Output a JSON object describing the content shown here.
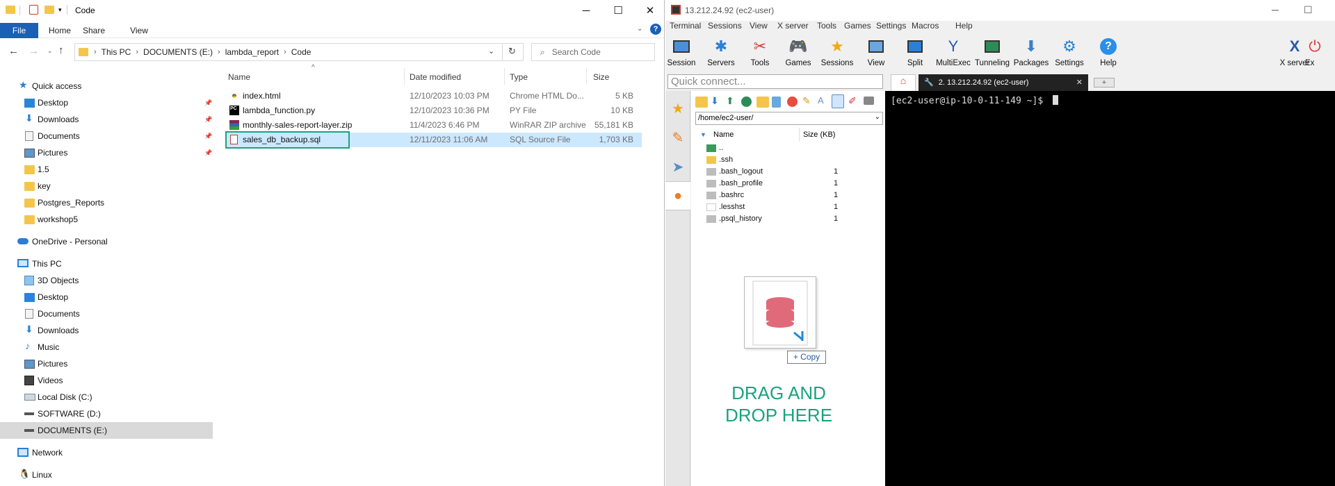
{
  "explorer": {
    "title": "Code",
    "ribbon_tabs": [
      "File",
      "Home",
      "Share",
      "View"
    ],
    "breadcrumb": [
      "This PC",
      "DOCUMENTS (E:)",
      "lambda_report",
      "Code"
    ],
    "search_placeholder": "Search Code",
    "nav_tree": [
      {
        "label": "Quick access",
        "icon": "star-icon",
        "indent": 0
      },
      {
        "label": "Desktop",
        "icon": "desktop-icon",
        "indent": 1,
        "pinned": true
      },
      {
        "label": "Downloads",
        "icon": "download-icon",
        "indent": 1,
        "pinned": true
      },
      {
        "label": "Documents",
        "icon": "documents-icon",
        "indent": 1,
        "pinned": true
      },
      {
        "label": "Pictures",
        "icon": "pictures-icon",
        "indent": 1,
        "pinned": true
      },
      {
        "label": "1.5",
        "icon": "folder-icon",
        "indent": 1
      },
      {
        "label": "key",
        "icon": "folder-icon",
        "indent": 1
      },
      {
        "label": "Postgres_Reports",
        "icon": "folder-icon",
        "indent": 1
      },
      {
        "label": "workshop5",
        "icon": "folder-icon",
        "indent": 1
      },
      {
        "label": "OneDrive - Personal",
        "icon": "cloud-icon",
        "indent": 0
      },
      {
        "label": "This PC",
        "icon": "computer-icon",
        "indent": 0
      },
      {
        "label": "3D Objects",
        "icon": "cube-icon",
        "indent": 1
      },
      {
        "label": "Desktop",
        "icon": "desktop-icon",
        "indent": 1
      },
      {
        "label": "Documents",
        "icon": "documents-icon",
        "indent": 1
      },
      {
        "label": "Downloads",
        "icon": "download-icon",
        "indent": 1
      },
      {
        "label": "Music",
        "icon": "music-icon",
        "indent": 1
      },
      {
        "label": "Pictures",
        "icon": "pictures-icon",
        "indent": 1
      },
      {
        "label": "Videos",
        "icon": "video-icon",
        "indent": 1
      },
      {
        "label": "Local Disk (C:)",
        "icon": "disk-icon",
        "indent": 1
      },
      {
        "label": "SOFTWARE (D:)",
        "icon": "drive-icon",
        "indent": 1
      },
      {
        "label": "DOCUMENTS (E:)",
        "icon": "drive-icon",
        "indent": 1,
        "selected": true
      },
      {
        "label": "Network",
        "icon": "network-icon",
        "indent": 0
      },
      {
        "label": "Linux",
        "icon": "linux-icon",
        "indent": 0
      }
    ],
    "columns": [
      "Name",
      "Date modified",
      "Type",
      "Size"
    ],
    "files": [
      {
        "name": "index.html",
        "date": "12/10/2023 10:03 PM",
        "type": "Chrome HTML Do...",
        "size": "5 KB",
        "icon": "chrome-icon"
      },
      {
        "name": "lambda_function.py",
        "date": "12/10/2023 10:36 PM",
        "type": "PY File",
        "size": "10 KB",
        "icon": "pycharm-icon"
      },
      {
        "name": "monthly-sales-report-layer.zip",
        "date": "11/4/2023 6:46 PM",
        "type": "WinRAR ZIP archive",
        "size": "55,181 KB",
        "icon": "winrar-icon"
      },
      {
        "name": "sales_db_backup.sql",
        "date": "12/11/2023 11:06 AM",
        "type": "SQL Source File",
        "size": "1,703 KB",
        "icon": "sql-file-icon",
        "selected": true
      }
    ],
    "accent": "#1b5fb7",
    "selection_color": "#cce8ff",
    "highlight_border": "#1aa37d"
  },
  "mobaxterm": {
    "title": "13.212.24.92 (ec2-user)",
    "menu": [
      "Terminal",
      "Sessions",
      "View",
      "X server",
      "Tools",
      "Games",
      "Settings",
      "Macros",
      "Help"
    ],
    "toolbar": [
      {
        "label": "Session",
        "icon": "session-icon"
      },
      {
        "label": "Servers",
        "icon": "servers-icon"
      },
      {
        "label": "Tools",
        "icon": "tools-icon"
      },
      {
        "label": "Games",
        "icon": "games-icon"
      },
      {
        "label": "Sessions",
        "icon": "sessions-star-icon"
      },
      {
        "label": "View",
        "icon": "view-icon"
      },
      {
        "label": "Split",
        "icon": "split-icon"
      },
      {
        "label": "MultiExec",
        "icon": "multiexec-icon"
      },
      {
        "label": "Tunneling",
        "icon": "tunneling-icon"
      },
      {
        "label": "Packages",
        "icon": "packages-icon"
      },
      {
        "label": "Settings",
        "icon": "settings-icon"
      },
      {
        "label": "Help",
        "icon": "help-icon"
      }
    ],
    "toolbar_right": [
      {
        "label": "X server",
        "icon": "xserver-icon"
      },
      {
        "label": "Ex",
        "icon": "exit-icon"
      }
    ],
    "quick_connect_placeholder": "Quick connect...",
    "tab_label": "2. 13.212.24.92 (ec2-user)",
    "sftp_path": "/home/ec2-user/",
    "sftp_columns": [
      "Name",
      "Size (KB)"
    ],
    "sftp_files": [
      {
        "name": "..",
        "size": "",
        "icon": "parent-folder-icon"
      },
      {
        "name": ".ssh",
        "size": "",
        "icon": "folder-icon"
      },
      {
        "name": ".bash_logout",
        "size": "1",
        "icon": "file-icon"
      },
      {
        "name": ".bash_profile",
        "size": "1",
        "icon": "file-icon"
      },
      {
        "name": ".bashrc",
        "size": "1",
        "icon": "file-icon"
      },
      {
        "name": ".lesshst",
        "size": "1",
        "icon": "blank-file-icon"
      },
      {
        "name": ".psql_history",
        "size": "1",
        "icon": "file-icon"
      }
    ],
    "copy_label": "+ Copy",
    "drag_line1": "DRAG AND",
    "drag_line2": "DROP HERE",
    "drag_color": "#1aa37d",
    "terminal_prompt": "[ec2-user@ip-10-0-11-149 ~]$"
  }
}
